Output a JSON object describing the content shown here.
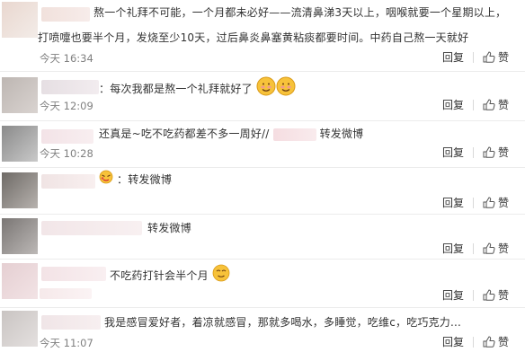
{
  "comments": [
    {
      "text_line1": "熬一个礼拜不可能，一个月都未必好——流清鼻涕3天以上，咽喉就要一个星期以上，",
      "text_line2": "打喷嚏也要半个月，发烧至少10天，过后鼻炎鼻塞黄粘痰都要时间。中药自己熬一天就好",
      "time": "今天 16:34",
      "reply": "回复",
      "like": "赞"
    },
    {
      "text": "：每次我都是熬一个礼拜就好了",
      "time": "今天 12:09",
      "reply": "回复",
      "like": "赞"
    },
    {
      "text": "还真是~吃不吃药都差不多一周好//",
      "text_suffix": "转发微博",
      "time": "今天 10:28",
      "reply": "回复",
      "like": "赞"
    },
    {
      "text": "：转发微博",
      "reply": "回复",
      "like": "赞"
    },
    {
      "text": "转发微博",
      "reply": "回复",
      "like": "赞"
    },
    {
      "text": "不吃药打针会半个月",
      "reply": "回复",
      "like": "赞"
    },
    {
      "text": "我是感冒爱好者，着凉就感冒，那就多喝水，多睡觉，吃维c，吃巧克力...",
      "time": "今天 11:07",
      "reply": "回复",
      "like": "赞"
    }
  ],
  "colors": {
    "time": "#808080",
    "text": "#333333",
    "divider": "#ececec"
  },
  "icons": {
    "like": "thumbs-up-icon",
    "smile": "smile-emoji-icon",
    "moved": "moved-emoji-icon"
  }
}
